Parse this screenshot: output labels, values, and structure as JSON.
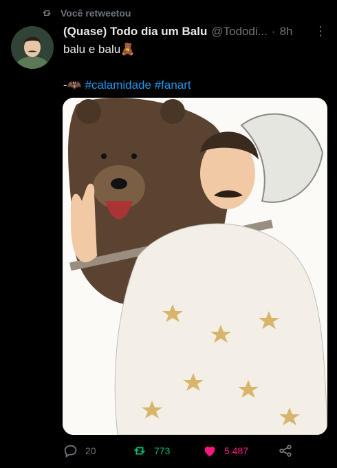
{
  "retweet_notice": "Você retweetou",
  "author": {
    "name": "(Quase) Todo dia um Balu",
    "handle": "@Tododi...",
    "time": "8h"
  },
  "tweet": {
    "line1": "balu  e balu🧸",
    "line2_prefix": "-🦇 ",
    "hashtags": [
      "#calamidade",
      "#fanart"
    ]
  },
  "stats": {
    "replies": "20",
    "retweets": "773",
    "likes": "5.487"
  },
  "colors": {
    "background": "#000000",
    "hashtag": "#1d9bf0",
    "retweet": "#00ba7c",
    "like": "#f91880"
  }
}
